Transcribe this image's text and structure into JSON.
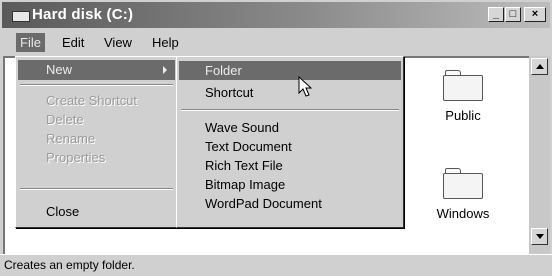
{
  "window": {
    "title": "Hard disk (C:)",
    "controls": {
      "minimize": "_",
      "restore": "□",
      "close": "×"
    }
  },
  "menubar": {
    "items": [
      "File",
      "Edit",
      "View",
      "Help"
    ]
  },
  "file_menu": {
    "items": [
      {
        "label": "New",
        "state": "selected",
        "has_submenu": true
      },
      {
        "label": "Create Shortcut",
        "state": "disabled"
      },
      {
        "label": "Delete",
        "state": "disabled"
      },
      {
        "label": "Rename",
        "state": "disabled"
      },
      {
        "label": "Properties",
        "state": "disabled"
      },
      {
        "label": "Close",
        "state": "enabled"
      }
    ]
  },
  "new_submenu": {
    "items": [
      {
        "label": "Folder",
        "state": "selected"
      },
      {
        "label": "Shortcut",
        "state": "enabled"
      },
      {
        "label": "Wave Sound",
        "state": "enabled"
      },
      {
        "label": "Text Document",
        "state": "enabled"
      },
      {
        "label": "Rich Text File",
        "state": "enabled"
      },
      {
        "label": "Bitmap Image",
        "state": "enabled"
      },
      {
        "label": "WordPad Document",
        "state": "enabled"
      }
    ]
  },
  "content": {
    "folders": [
      {
        "label": "Public",
        "icon": "folder-icon"
      },
      {
        "label": "Windows",
        "icon": "folder-icon"
      }
    ]
  },
  "statusbar": {
    "text": "Creates an empty folder."
  },
  "colors": {
    "highlight": "#6b6b6b",
    "face": "#d0d0d0",
    "disabled_text": "#9b9b9b"
  }
}
